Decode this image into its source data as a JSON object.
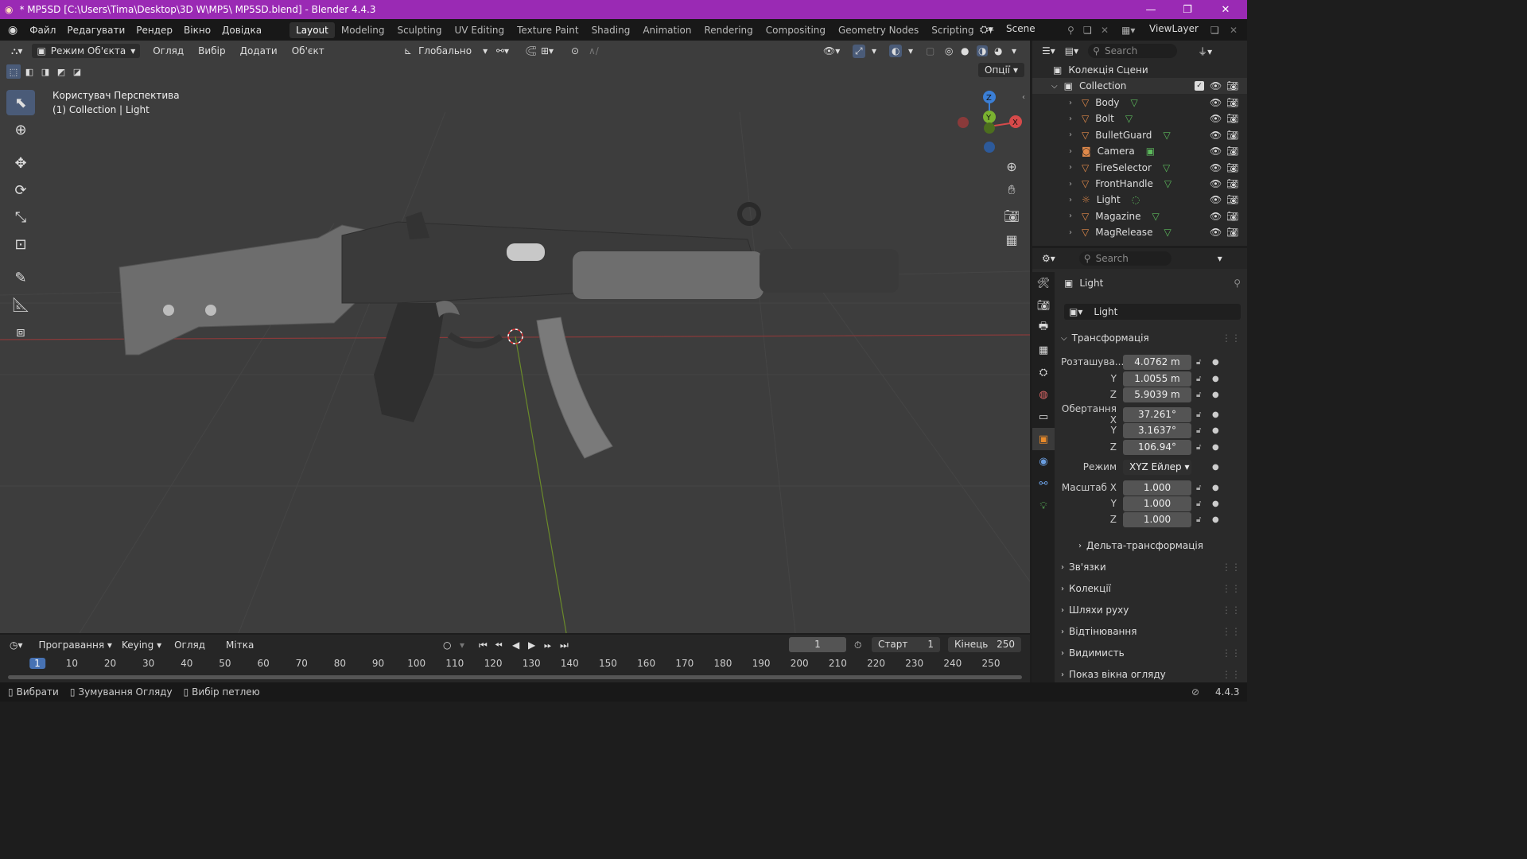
{
  "title": "* MP5SD [C:\\Users\\Tima\\Desktop\\3D W\\MP5\\ MP5SD.blend] - Blender 4.4.3",
  "window_controls": {
    "minimize": "—",
    "maximize": "❐",
    "close": "✕"
  },
  "menu": [
    "Файл",
    "Редагувати",
    "Рендер",
    "Вікно",
    "Довідка"
  ],
  "workspaces": [
    "Layout",
    "Modeling",
    "Sculpting",
    "UV Editing",
    "Texture Paint",
    "Shading",
    "Animation",
    "Rendering",
    "Compositing",
    "Geometry Nodes",
    "Scripting"
  ],
  "workspace_add": "+",
  "scene": {
    "name": "Scene",
    "view_layer": "ViewLayer"
  },
  "viewport": {
    "mode": "Режим Об'єкта",
    "menus": [
      "Огляд",
      "Вибір",
      "Додати",
      "Об'єкт"
    ],
    "transform_orientation": "Глобально",
    "options": "Опції",
    "view_name": "Користувач Перспектива",
    "context": "(1) Collection | Light"
  },
  "gizmo": {
    "z": "Z",
    "y": "Y",
    "x": "X"
  },
  "outliner": {
    "search_placeholder": "Search",
    "root": "Колекція Сцени",
    "collection": "Collection",
    "items": [
      {
        "name": "Body",
        "type": "mesh"
      },
      {
        "name": "Bolt",
        "type": "mesh"
      },
      {
        "name": "BulletGuard",
        "type": "mesh"
      },
      {
        "name": "Camera",
        "type": "camera"
      },
      {
        "name": "FireSelector",
        "type": "mesh"
      },
      {
        "name": "FrontHandle",
        "type": "mesh"
      },
      {
        "name": "Light",
        "type": "light"
      },
      {
        "name": "Magazine",
        "type": "mesh"
      },
      {
        "name": "MagRelease",
        "type": "mesh"
      }
    ]
  },
  "properties": {
    "search_placeholder": "Search",
    "object_name": "Light",
    "data_name": "Light",
    "transform_title": "Трансформація",
    "location_label": "Розташува...",
    "rotation_label": "Обертання X",
    "scale_label": "Масштаб X",
    "axis_y": "Y",
    "axis_z": "Z",
    "location": [
      "4.0762 m",
      "1.0055 m",
      "5.9039 m"
    ],
    "rotation": [
      "37.261°",
      "3.1637°",
      "106.94°"
    ],
    "mode_label": "Режим",
    "mode_value": "XYZ Ейлер",
    "scale": [
      "1.000",
      "1.000",
      "1.000"
    ],
    "delta": "Дельта-трансформація",
    "sections": [
      "Зв'язки",
      "Колекції",
      "Шляхи руху",
      "Відтінювання",
      "Видимисть",
      "Показ вікна огляду"
    ]
  },
  "timeline": {
    "menus": [
      "Програвання",
      "Keying",
      "Огляд",
      "Мітка"
    ],
    "current_frame": "1",
    "start_label": "Старт",
    "start": "1",
    "end_label": "Кінець",
    "end": "250",
    "ruler": [
      "1",
      "10",
      "20",
      "30",
      "40",
      "50",
      "60",
      "70",
      "80",
      "90",
      "100",
      "110",
      "120",
      "130",
      "140",
      "150",
      "160",
      "170",
      "180",
      "190",
      "200",
      "210",
      "220",
      "230",
      "240",
      "250"
    ]
  },
  "status": {
    "select": "Вибрати",
    "zoom": "Зумування Огляду",
    "loop": "Вибір петлею",
    "version": "4.4.3"
  }
}
